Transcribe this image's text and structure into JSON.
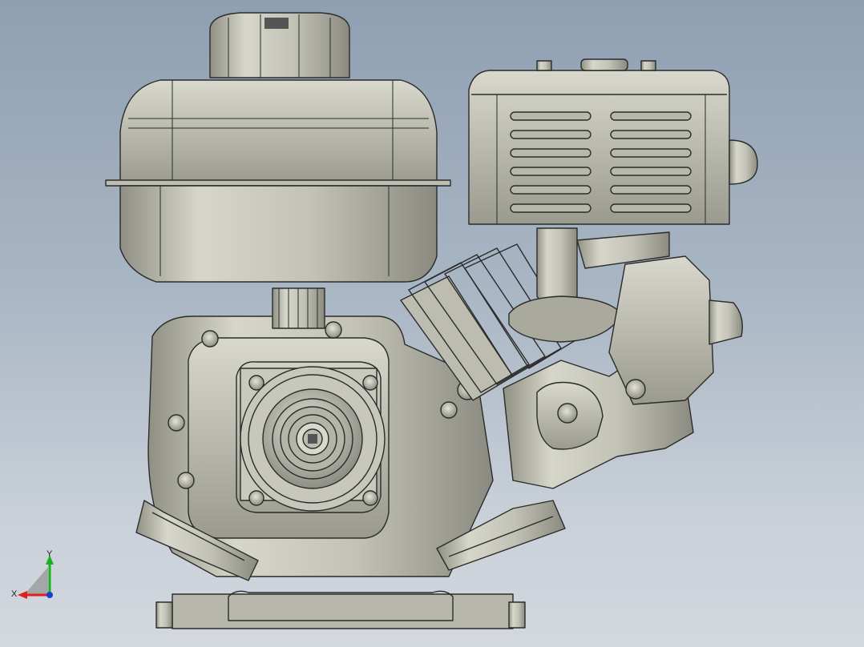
{
  "viewport": {
    "title": "engine-model-view"
  },
  "triad": {
    "x_label": "X",
    "y_label": "Y",
    "x_color": "#e02020",
    "y_color": "#19b31b",
    "z_color": "#1a3fd0"
  },
  "model": {
    "body_color": "#c8c8bc",
    "shade_color": "#9a9a8e",
    "line_color": "#2b2b2b"
  }
}
